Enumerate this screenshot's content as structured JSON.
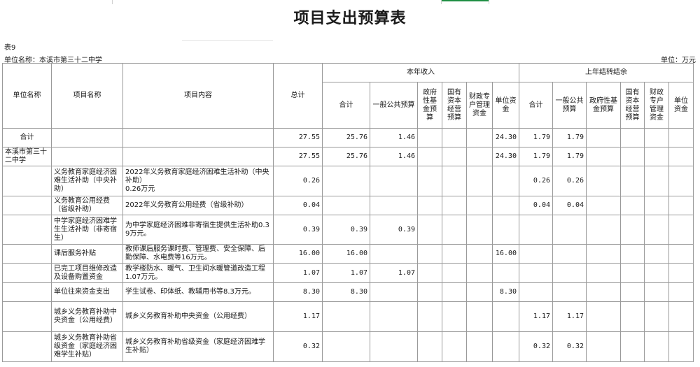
{
  "title": "项目支出预算表",
  "table_no": "表9",
  "unit_name": "单位名称：本溪市第三十二中学",
  "unit_measure": "单位：万元",
  "headers": {
    "unit": "单位名称",
    "project": "项目名称",
    "content": "项目内容",
    "total": "总计",
    "current_income": "本年收入",
    "carryover": "上年结转结余",
    "cur_cols": [
      "合计",
      "一般公共预算",
      "政府性基金预算",
      "国有资本经营预算",
      "财政专户管理资金",
      "单位资金"
    ],
    "carry_cols": [
      "合计",
      "一般公共预算",
      "政府性基金预算",
      "国有资本经营预算",
      "财政专户管理资金",
      "单位资金"
    ]
  },
  "rows": [
    {
      "unit": "合计",
      "project": "",
      "content": "",
      "total": "27.55",
      "cur": [
        "25.76",
        "1.46",
        "",
        "",
        "",
        "24.30"
      ],
      "carry": [
        "1.79",
        "1.79",
        "",
        "",
        "",
        ""
      ]
    },
    {
      "unit": "本溪市第三十二中学",
      "project": "",
      "content": "",
      "total": "27.55",
      "cur": [
        "25.76",
        "1.46",
        "",
        "",
        "",
        "24.30"
      ],
      "carry": [
        "1.79",
        "1.79",
        "",
        "",
        "",
        ""
      ]
    },
    {
      "unit": "",
      "project": "义务教育家庭经济困难生活补助（中央补助）",
      "content": "2022年义务教育家庭经济困难生活补助（中央补助）\n0.26万元",
      "total": "0.26",
      "cur": [
        "",
        "",
        "",
        "",
        "",
        ""
      ],
      "carry": [
        "0.26",
        "0.26",
        "",
        "",
        "",
        ""
      ]
    },
    {
      "unit": "",
      "project": "义务教育公用经费（省级补助）",
      "content": "2022年义务教育公用经费（省级补助）",
      "total": "0.04",
      "cur": [
        "",
        "",
        "",
        "",
        "",
        ""
      ],
      "carry": [
        "0.04",
        "0.04",
        "",
        "",
        "",
        ""
      ]
    },
    {
      "unit": "",
      "project": "中学家庭经济困难学生生活补助（非寄宿生）",
      "content": "为中学家庭经济困难非寄宿生提供生活补助0.39万元。",
      "total": "0.39",
      "cur": [
        "0.39",
        "0.39",
        "",
        "",
        "",
        ""
      ],
      "carry": [
        "",
        "",
        "",
        "",
        "",
        ""
      ]
    },
    {
      "unit": "",
      "project": "课后服务补贴",
      "content": "教师课后服务课时费、管理费、安全保障、后勤保障、水电费等16万元。",
      "total": "16.00",
      "cur": [
        "16.00",
        "",
        "",
        "",
        "",
        "16.00"
      ],
      "carry": [
        "",
        "",
        "",
        "",
        "",
        ""
      ]
    },
    {
      "unit": "",
      "project": "已完工项目维修改造及设备购置资金",
      "content": "教学楼防水、暖气、卫生间水暖管道改造工程1.07万元。",
      "total": "1.07",
      "cur": [
        "1.07",
        "1.07",
        "",
        "",
        "",
        ""
      ],
      "carry": [
        "",
        "",
        "",
        "",
        "",
        ""
      ]
    },
    {
      "unit": "",
      "project": "单位往来资金支出",
      "content": "学生试卷、印体纸、教辅用书等8.3万元。",
      "total": "8.30",
      "cur": [
        "8.30",
        "",
        "",
        "",
        "",
        "8.30"
      ],
      "carry": [
        "",
        "",
        "",
        "",
        "",
        ""
      ]
    },
    {
      "unit": "",
      "project": "城乡义务教育补助中央资金（公用经费）",
      "content": "城乡义务教育补助中央资金（公用经费）",
      "total": "1.17",
      "cur": [
        "",
        "",
        "",
        "",
        "",
        ""
      ],
      "carry": [
        "1.17",
        "1.17",
        "",
        "",
        "",
        ""
      ]
    },
    {
      "unit": "",
      "project": "城乡义务教育补助省级资金（家庭经济困难学生补贴）",
      "content": "城乡义务教育补助省级资金（家庭经济困难学生补贴）",
      "total": "0.32",
      "cur": [
        "",
        "",
        "",
        "",
        "",
        ""
      ],
      "carry": [
        "0.32",
        "0.32",
        "",
        "",
        "",
        ""
      ]
    }
  ]
}
